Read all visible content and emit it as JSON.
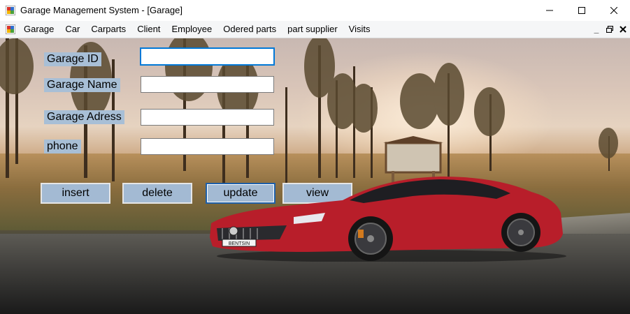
{
  "window": {
    "title": "Garage Management System - [Garage]",
    "icons": {
      "app": "app-icon",
      "minimize": "minimize-icon",
      "maximize": "maximize-icon",
      "close": "close-icon"
    }
  },
  "menu": {
    "items": [
      "Garage",
      "Car",
      "Carparts",
      "Client",
      "Employee",
      "Odered parts",
      "part supplier",
      "Visits"
    ],
    "mdi_controls": {
      "minimize": "_",
      "restore": "restore-icon",
      "close": "close-icon"
    }
  },
  "form": {
    "labels": {
      "garage_id": "Garage ID",
      "garage_name": "Garage Name",
      "garage_address": "Garage Adress",
      "phone": "phone"
    },
    "values": {
      "garage_id": "",
      "garage_name": "",
      "garage_address": "",
      "phone": ""
    }
  },
  "buttons": {
    "insert": "insert",
    "delete": "delete",
    "update": "update",
    "view": "view"
  },
  "car": {
    "plate": "BENTSIN"
  },
  "colors": {
    "label_bg": "#a8bfd6",
    "button_bg": "#a3bad3",
    "focus_border": "#0078d7",
    "car_red": "#b81e2a"
  }
}
